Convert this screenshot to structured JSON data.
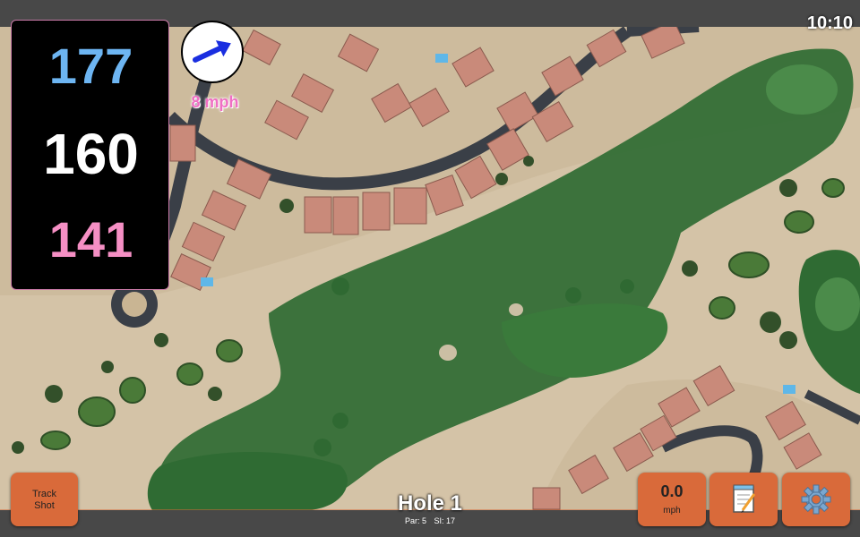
{
  "status": {
    "time": "10:10"
  },
  "yardage": {
    "back": "177",
    "center": "160",
    "front": "141"
  },
  "wind": {
    "speed_label": "8 mph",
    "direction_icon": "wind-arrow-icon",
    "arrow_color": "#1a2ee0"
  },
  "hole": {
    "title": "Hole 1",
    "par_label": "Par: 5",
    "si_label": "SI: 17"
  },
  "buttons": {
    "track_shot_label_line1": "Track",
    "track_shot_label_line2": "Shot",
    "speed_value": "0.0",
    "speed_unit": "mph",
    "notes_icon": "notepad-icon",
    "settings_icon": "gear-icon"
  },
  "colors": {
    "back": "#6db5f2",
    "center": "#ffffff",
    "front": "#f58fc4",
    "button": "#d96a3a",
    "wind_text": "#f06fc4"
  }
}
